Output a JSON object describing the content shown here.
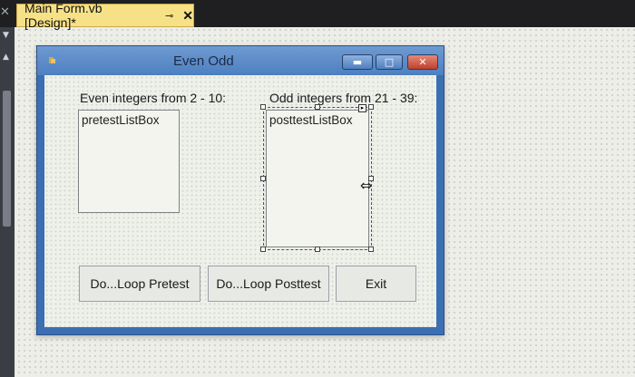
{
  "tab": {
    "title": "Main Form.vb [Design]*",
    "pin_icon": "pin-icon",
    "close_icon": "close-icon"
  },
  "form": {
    "title": "Even Odd",
    "window_buttons": [
      "minimize",
      "maximize",
      "close"
    ]
  },
  "labels": {
    "even": "Even integers from 2 - 10:",
    "odd": "Odd integers from 21 - 39:"
  },
  "listboxes": {
    "pretest": "pretestListBox",
    "posttest": "posttestListBox"
  },
  "buttons": {
    "pretest": "Do...Loop Pretest",
    "posttest": "Do...Loop Posttest",
    "exit": "Exit"
  },
  "colors": {
    "tab_active": "#f6e186",
    "title_bar": "#4d7fc0",
    "close_button": "#c2402b"
  }
}
